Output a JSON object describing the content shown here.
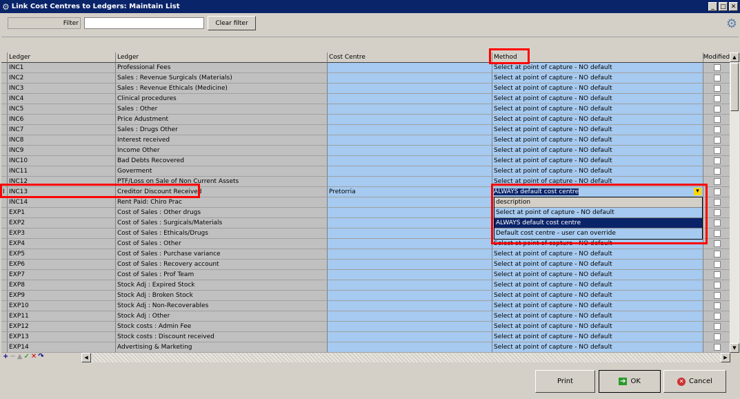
{
  "window": {
    "title": "Link Cost Centres to Ledgers: Maintain List",
    "min": "_",
    "max": "□",
    "close": "✕"
  },
  "filter": {
    "label": "Filter",
    "value": "",
    "clear_label": "Clear filter"
  },
  "columns": [
    "Ledger",
    "Ledger",
    "Cost Centre",
    "Method",
    "Modified"
  ],
  "rows": [
    [
      "INC1",
      "Professional Fees",
      "",
      "Select at point of capture - NO default"
    ],
    [
      "INC2",
      "Sales : Revenue Surgicals (Materials)",
      "",
      "Select at point of capture - NO default"
    ],
    [
      "INC3",
      "Sales : Revenue Ethicals (Medicine)",
      "",
      "Select at point of capture - NO default"
    ],
    [
      "INC4",
      "Clinical procedures",
      "",
      "Select at point of capture - NO default"
    ],
    [
      "INC5",
      "Sales : Other",
      "",
      "Select at point of capture - NO default"
    ],
    [
      "INC6",
      "Price Adustment",
      "",
      "Select at point of capture - NO default"
    ],
    [
      "INC7",
      "Sales : Drugs Other",
      "",
      "Select at point of capture - NO default"
    ],
    [
      "INC8",
      "Interest received",
      "",
      "Select at point of capture - NO default"
    ],
    [
      "INC9",
      "Income Other",
      "",
      "Select at point of capture - NO default"
    ],
    [
      "INC10",
      "Bad Debts Recovered",
      "",
      "Select at point of capture - NO default"
    ],
    [
      "INC11",
      "Goverment",
      "",
      "Select at point of capture - NO default"
    ],
    [
      "INC12",
      "PTF/Loss on Sale of Non Current Assets",
      "",
      "Select at point of capture - NO default"
    ],
    [
      "INC13",
      "Creditor Discount Received",
      "Pretorria",
      "ALWAYS default cost centre"
    ],
    [
      "INC14",
      "Rent Paid: Chiro Prac",
      "",
      "Select at point of capture - NO default"
    ],
    [
      "EXP1",
      "Cost of Sales : Other drugs",
      "",
      "Select at point of capture - NO default"
    ],
    [
      "EXP2",
      "Cost of Sales : Surgicals/Materials",
      "",
      "Select at point of capture - NO default"
    ],
    [
      "EXP3",
      "Cost of Sales : Ethicals/Drugs",
      "",
      "Select at point of capture - NO default"
    ],
    [
      "EXP4",
      "Cost of Sales : Other",
      "",
      "Select at point of capture - NO default"
    ],
    [
      "EXP5",
      "Cost of Sales : Purchase variance",
      "",
      "Select at point of capture - NO default"
    ],
    [
      "EXP6",
      "Cost of Sales : Recovery account",
      "",
      "Select at point of capture - NO default"
    ],
    [
      "EXP7",
      "Cost of Sales : Prof Team",
      "",
      "Select at point of capture - NO default"
    ],
    [
      "EXP8",
      "Stock Adj : Expired Stock",
      "",
      "Select at point of capture - NO default"
    ],
    [
      "EXP9",
      "Stock Adj : Broken Stock",
      "",
      "Select at point of capture - NO default"
    ],
    [
      "EXP10",
      "Stock Adj : Non-Recoverables",
      "",
      "Select at point of capture - NO default"
    ],
    [
      "EXP11",
      "Stock Adj : Other",
      "",
      "Select at point of capture - NO default"
    ],
    [
      "EXP12",
      "Stock costs : Admin Fee",
      "",
      "Select at point of capture - NO default"
    ],
    [
      "EXP13",
      "Stock costs : Discount received",
      "",
      "Select at point of capture - NO default"
    ],
    [
      "EXP14",
      "Advertising & Marketing",
      "",
      "Select at point of capture - NO default"
    ]
  ],
  "active_row_index": 12,
  "current_row_marker": "I",
  "dropdown": {
    "header": "description",
    "options": [
      "Select at point of capture - NO default",
      "ALWAYS default cost centre",
      "Default cost centre - user can override"
    ],
    "selected": "ALWAYS default cost centre"
  },
  "navigator": [
    "+",
    "−",
    "▲",
    "✓",
    "✕",
    "↷"
  ],
  "buttons": {
    "print": "Print",
    "ok": "OK",
    "cancel": "Cancel"
  },
  "colors": {
    "title": "#0a246a",
    "cell_blue": "#a6caf0",
    "highlight": "#ff0000",
    "selected": "#0a246a"
  }
}
